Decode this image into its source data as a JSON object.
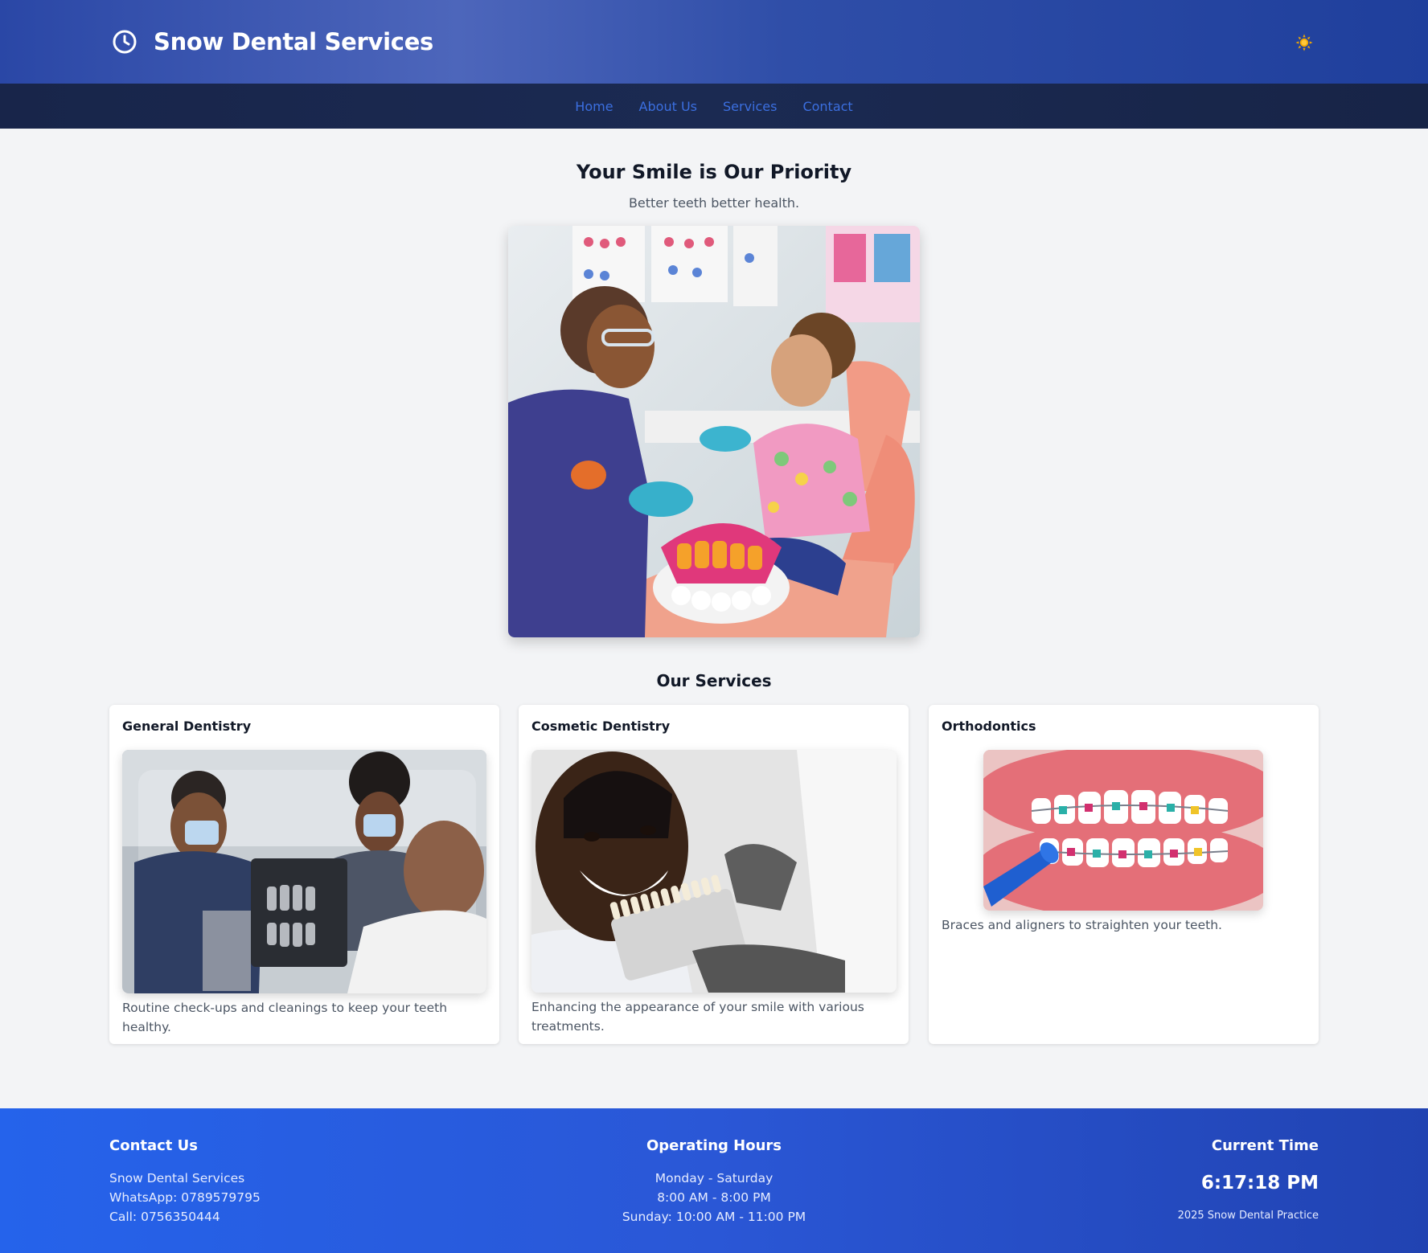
{
  "header": {
    "title": "Snow Dental Services",
    "logo_icon": "clock-icon",
    "theme_toggle_icon": "sun-icon"
  },
  "nav": {
    "items": [
      "Home",
      "About Us",
      "Services",
      "Contact"
    ]
  },
  "hero": {
    "title": "Your Smile is Our Priority",
    "subtitle": "Better teeth better health."
  },
  "services": {
    "title": "Our Services",
    "cards": [
      {
        "title": "General Dentistry",
        "description": "Routine check-ups and cleanings to keep your teeth healthy."
      },
      {
        "title": "Cosmetic Dentistry",
        "description": "Enhancing the appearance of your smile with various treatments."
      },
      {
        "title": "Orthodontics",
        "description": "Braces and aligners to straighten your teeth."
      }
    ]
  },
  "footer": {
    "contact": {
      "title": "Contact Us",
      "name": "Snow Dental Services",
      "whatsapp": "WhatsApp: 0789579795",
      "call": "Call: 0756350444"
    },
    "hours": {
      "title": "Operating Hours",
      "weekday_days": "Monday - Saturday",
      "weekday_hours": "8:00 AM - 8:00 PM",
      "sunday": "Sunday: 10:00 AM - 11:00 PM"
    },
    "time": {
      "title": "Current Time",
      "value": "6:17:18 PM",
      "copyright": "2025 Snow Dental Practice"
    }
  },
  "colors": {
    "header": "#2f4ea8",
    "nav": "#1b2a52",
    "nav_link": "#3b6fe0",
    "footer": "#2563eb",
    "page_bg": "#f3f4f6"
  }
}
